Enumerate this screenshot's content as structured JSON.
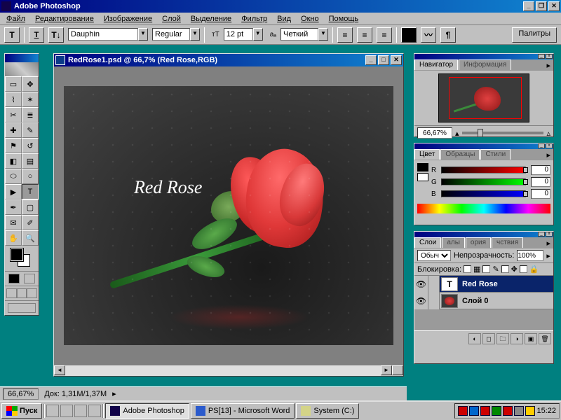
{
  "app": {
    "title": "Adobe Photoshop"
  },
  "menu": [
    "Файл",
    "Редактирование",
    "Изображение",
    "Слой",
    "Выделение",
    "Фильтр",
    "Вид",
    "Окно",
    "Помощь"
  ],
  "options": {
    "font_family": "Dauphin",
    "font_style": "Regular",
    "font_size": "12 pt",
    "antialias": "Четкий",
    "palette_btn": "Палитры"
  },
  "document": {
    "title": "RedRose1.psd @ 66,7% (Red Rose,RGB)",
    "overlay_text": "Red Rose"
  },
  "navigator": {
    "tab_active": "Навигатор",
    "tab_2": "Информация",
    "zoom": "66,67%"
  },
  "color": {
    "tab_active": "Цвет",
    "tab_2": "Образцы",
    "tab_3": "Стили",
    "r_label": "R",
    "g_label": "G",
    "b_label": "B",
    "r": "0",
    "g": "0",
    "b": "0"
  },
  "layers": {
    "tabs": [
      "Слои",
      "алы",
      "ория",
      "чствия"
    ],
    "blend_label": "Обыч.",
    "opacity_label": "Непрозрачность:",
    "opacity_value": "100%",
    "lock_label": "Блокировка:",
    "items": [
      {
        "name": "Red Rose",
        "type": "T",
        "selected": true
      },
      {
        "name": "Слой 0",
        "type": "img",
        "selected": false
      }
    ]
  },
  "status": {
    "zoom": "66,67%",
    "doc": "Док: 1,31M/1,37M"
  },
  "taskbar": {
    "start": "Пуск",
    "tasks": [
      {
        "label": "Adobe Photoshop",
        "active": true,
        "iconColor": "#12034a"
      },
      {
        "label": "PS[13] - Microsoft Word",
        "active": false,
        "iconColor": "#2a5acc"
      },
      {
        "label": "System (C:)",
        "active": false,
        "iconColor": "#d4d488"
      }
    ],
    "clock": "15:22"
  }
}
